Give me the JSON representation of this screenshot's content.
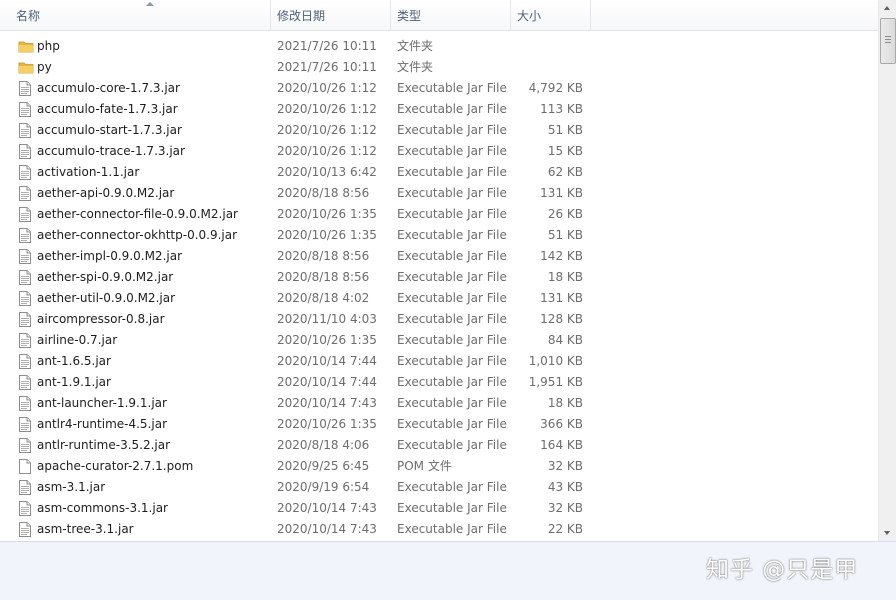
{
  "header": {
    "name": "名称",
    "date": "修改日期",
    "type": "类型",
    "size": "大小"
  },
  "colors": {
    "folder": "#e8b640",
    "header_text": "#4c607a",
    "secondary_text": "#6d6d6d"
  },
  "files": [
    {
      "icon": "folder-icon",
      "name": "php",
      "date": "2021/7/26 10:11",
      "type": "文件夹",
      "size": ""
    },
    {
      "icon": "folder-icon",
      "name": "py",
      "date": "2021/7/26 10:11",
      "type": "文件夹",
      "size": ""
    },
    {
      "icon": "jar-file-icon",
      "name": "accumulo-core-1.7.3.jar",
      "date": "2020/10/26 1:12",
      "type": "Executable Jar File",
      "size": "4,792 KB"
    },
    {
      "icon": "jar-file-icon",
      "name": "accumulo-fate-1.7.3.jar",
      "date": "2020/10/26 1:12",
      "type": "Executable Jar File",
      "size": "113 KB"
    },
    {
      "icon": "jar-file-icon",
      "name": "accumulo-start-1.7.3.jar",
      "date": "2020/10/26 1:12",
      "type": "Executable Jar File",
      "size": "51 KB"
    },
    {
      "icon": "jar-file-icon",
      "name": "accumulo-trace-1.7.3.jar",
      "date": "2020/10/26 1:12",
      "type": "Executable Jar File",
      "size": "15 KB"
    },
    {
      "icon": "jar-file-icon",
      "name": "activation-1.1.jar",
      "date": "2020/10/13 6:42",
      "type": "Executable Jar File",
      "size": "62 KB"
    },
    {
      "icon": "jar-file-icon",
      "name": "aether-api-0.9.0.M2.jar",
      "date": "2020/8/18 8:56",
      "type": "Executable Jar File",
      "size": "131 KB"
    },
    {
      "icon": "jar-file-icon",
      "name": "aether-connector-file-0.9.0.M2.jar",
      "date": "2020/10/26 1:35",
      "type": "Executable Jar File",
      "size": "26 KB"
    },
    {
      "icon": "jar-file-icon",
      "name": "aether-connector-okhttp-0.0.9.jar",
      "date": "2020/10/26 1:35",
      "type": "Executable Jar File",
      "size": "51 KB"
    },
    {
      "icon": "jar-file-icon",
      "name": "aether-impl-0.9.0.M2.jar",
      "date": "2020/8/18 8:56",
      "type": "Executable Jar File",
      "size": "142 KB"
    },
    {
      "icon": "jar-file-icon",
      "name": "aether-spi-0.9.0.M2.jar",
      "date": "2020/8/18 8:56",
      "type": "Executable Jar File",
      "size": "18 KB"
    },
    {
      "icon": "jar-file-icon",
      "name": "aether-util-0.9.0.M2.jar",
      "date": "2020/8/18 4:02",
      "type": "Executable Jar File",
      "size": "131 KB"
    },
    {
      "icon": "jar-file-icon",
      "name": "aircompressor-0.8.jar",
      "date": "2020/11/10 4:03",
      "type": "Executable Jar File",
      "size": "128 KB"
    },
    {
      "icon": "jar-file-icon",
      "name": "airline-0.7.jar",
      "date": "2020/10/26 1:35",
      "type": "Executable Jar File",
      "size": "84 KB"
    },
    {
      "icon": "jar-file-icon",
      "name": "ant-1.6.5.jar",
      "date": "2020/10/14 7:44",
      "type": "Executable Jar File",
      "size": "1,010 KB"
    },
    {
      "icon": "jar-file-icon",
      "name": "ant-1.9.1.jar",
      "date": "2020/10/14 7:44",
      "type": "Executable Jar File",
      "size": "1,951 KB"
    },
    {
      "icon": "jar-file-icon",
      "name": "ant-launcher-1.9.1.jar",
      "date": "2020/10/14 7:43",
      "type": "Executable Jar File",
      "size": "18 KB"
    },
    {
      "icon": "jar-file-icon",
      "name": "antlr4-runtime-4.5.jar",
      "date": "2020/10/26 1:35",
      "type": "Executable Jar File",
      "size": "366 KB"
    },
    {
      "icon": "jar-file-icon",
      "name": "antlr-runtime-3.5.2.jar",
      "date": "2020/8/18 4:06",
      "type": "Executable Jar File",
      "size": "164 KB"
    },
    {
      "icon": "blank-file-icon",
      "name": "apache-curator-2.7.1.pom",
      "date": "2020/9/25 6:45",
      "type": "POM 文件",
      "size": "32 KB"
    },
    {
      "icon": "jar-file-icon",
      "name": "asm-3.1.jar",
      "date": "2020/9/19 6:54",
      "type": "Executable Jar File",
      "size": "43 KB"
    },
    {
      "icon": "jar-file-icon",
      "name": "asm-commons-3.1.jar",
      "date": "2020/10/14 7:43",
      "type": "Executable Jar File",
      "size": "32 KB"
    },
    {
      "icon": "jar-file-icon",
      "name": "asm-tree-3.1.jar",
      "date": "2020/10/14 7:43",
      "type": "Executable Jar File",
      "size": "22 KB"
    }
  ],
  "watermark": "知乎 @只是甲"
}
